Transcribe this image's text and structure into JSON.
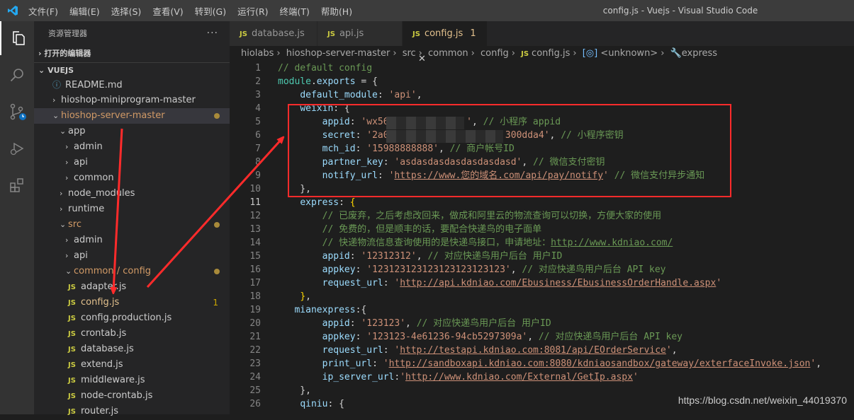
{
  "titlebar": {
    "menu": [
      "文件(F)",
      "编辑(E)",
      "选择(S)",
      "查看(V)",
      "转到(G)",
      "运行(R)",
      "终端(T)",
      "帮助(H)"
    ],
    "window_title": "config.js - Vuejs - Visual Studio Code"
  },
  "activity_icons": [
    "explorer-icon",
    "search-icon",
    "source-control-icon",
    "run-debug-icon",
    "extensions-icon"
  ],
  "sidebar": {
    "title": "资源管理器",
    "more": "···",
    "open_editors": "打开的编辑器",
    "workspace": "VUEJS",
    "tree": [
      {
        "label": "README.md",
        "icon": "info",
        "depth": 1
      },
      {
        "label": "hioshop-miniprogram-master",
        "icon": "chevron-right",
        "depth": 1
      },
      {
        "label": "hioshop-server-master",
        "icon": "chevron-down",
        "depth": 1,
        "selected": true,
        "dot": true,
        "git": true
      },
      {
        "label": "app",
        "icon": "chevron-down",
        "depth": 2
      },
      {
        "label": "admin",
        "icon": "chevron-right",
        "depth": 3
      },
      {
        "label": "api",
        "icon": "chevron-right",
        "depth": 3
      },
      {
        "label": "common",
        "icon": "chevron-right",
        "depth": 3
      },
      {
        "label": "node_modules",
        "icon": "chevron-right",
        "depth": 2
      },
      {
        "label": "runtime",
        "icon": "chevron-right",
        "depth": 2
      },
      {
        "label": "src",
        "icon": "chevron-down",
        "depth": 2,
        "dot": true,
        "git": true
      },
      {
        "label": "admin",
        "icon": "chevron-right",
        "depth": 3
      },
      {
        "label": "api",
        "icon": "chevron-right",
        "depth": 3
      },
      {
        "label": "common / config",
        "icon": "chevron-down",
        "depth": 3,
        "dot": true,
        "git": true
      },
      {
        "label": "adapter.js",
        "icon": "js",
        "depth": 4
      },
      {
        "label": "config.js",
        "icon": "js",
        "depth": 4,
        "badge": "1",
        "mod": true
      },
      {
        "label": "config.production.js",
        "icon": "js",
        "depth": 4
      },
      {
        "label": "crontab.js",
        "icon": "js",
        "depth": 4
      },
      {
        "label": "database.js",
        "icon": "js",
        "depth": 4
      },
      {
        "label": "extend.js",
        "icon": "js",
        "depth": 4
      },
      {
        "label": "middleware.js",
        "icon": "js",
        "depth": 4
      },
      {
        "label": "node-crontab.js",
        "icon": "js",
        "depth": 4
      },
      {
        "label": "router.js",
        "icon": "js",
        "depth": 4
      }
    ]
  },
  "tabs": [
    {
      "label": "database.js",
      "icon": "JS"
    },
    {
      "label": "api.js",
      "icon": "JS"
    },
    {
      "label": "config.js",
      "icon": "JS",
      "badge": "1",
      "active": true
    }
  ],
  "breadcrumb": [
    "hiolabs",
    "hioshop-server-master",
    "src",
    "common",
    "config",
    "config.js",
    "<unknown>",
    "express"
  ],
  "code": {
    "line_numbers": [
      "1",
      "2",
      "3",
      "4",
      "5",
      "6",
      "7",
      "8",
      "9",
      "10",
      "11",
      "12",
      "13",
      "14",
      "15",
      "16",
      "17",
      "18",
      "19",
      "20",
      "21",
      "22",
      "23",
      "24",
      "25",
      "26"
    ],
    "current_line": "11",
    "lines": [
      [
        [
          "com",
          "// default config"
        ]
      ],
      [
        [
          "mod",
          "module"
        ],
        [
          "ok",
          "."
        ],
        [
          "kw",
          "exports"
        ],
        [
          "ok",
          " = {"
        ]
      ],
      [
        [
          "ok",
          "    "
        ],
        [
          "kw",
          "default_module"
        ],
        [
          "ok",
          ": "
        ],
        [
          "str",
          "'api'"
        ],
        [
          "ok",
          ","
        ]
      ],
      [
        [
          "ok",
          "    "
        ],
        [
          "kw",
          "weixin"
        ],
        [
          "ok",
          ": {"
        ]
      ],
      [
        [
          "ok",
          "        "
        ],
        [
          "kw",
          "appid"
        ],
        [
          "ok",
          ": "
        ],
        [
          "str",
          "'wx56              '"
        ],
        [
          "ok",
          ", "
        ],
        [
          "com",
          "// 小程序 appid"
        ]
      ],
      [
        [
          "ok",
          "        "
        ],
        [
          "kw",
          "secret"
        ],
        [
          "ok",
          ": "
        ],
        [
          "str",
          "'2a0                     300dda4'"
        ],
        [
          "ok",
          ", "
        ],
        [
          "com",
          "// 小程序密钥"
        ]
      ],
      [
        [
          "ok",
          "        "
        ],
        [
          "kw",
          "mch_id"
        ],
        [
          "ok",
          ": "
        ],
        [
          "str",
          "'15988888888'"
        ],
        [
          "ok",
          ", "
        ],
        [
          "com",
          "// 商户帐号ID"
        ]
      ],
      [
        [
          "ok",
          "        "
        ],
        [
          "kw",
          "partner_key"
        ],
        [
          "ok",
          ": "
        ],
        [
          "str",
          "'asdasdasdasdasdasdasd'"
        ],
        [
          "ok",
          ", "
        ],
        [
          "com",
          "// 微信支付密钥"
        ]
      ],
      [
        [
          "ok",
          "        "
        ],
        [
          "kw",
          "notify_url"
        ],
        [
          "ok",
          ": "
        ],
        [
          "str",
          "'"
        ],
        [
          "url",
          "https://www.您的域名.com/api/pay/notify"
        ],
        [
          "str",
          "'"
        ],
        [
          "ok",
          " "
        ],
        [
          "com",
          "// 微信支付异步通知"
        ]
      ],
      [
        [
          "ok",
          "    },"
        ]
      ],
      [
        [
          "ok",
          "    "
        ],
        [
          "kw",
          "express"
        ],
        [
          "ok",
          ": "
        ],
        [
          "brk",
          "{"
        ]
      ],
      [
        [
          "ok",
          "        "
        ],
        [
          "com",
          "// 已废弃，之后考虑改回来，做成和阿里云的物流查询可以切换，方便大家的使用"
        ]
      ],
      [
        [
          "ok",
          "        "
        ],
        [
          "com",
          "// 免费的，但是顺丰的话，要配合快递鸟的电子面单"
        ]
      ],
      [
        [
          "ok",
          "        "
        ],
        [
          "com",
          "// 快递物流信息查询使用的是快递鸟接口，申请地址："
        ],
        [
          "curl",
          "http://www.kdniao.com/"
        ]
      ],
      [
        [
          "ok",
          "        "
        ],
        [
          "kw",
          "appid"
        ],
        [
          "ok",
          ": "
        ],
        [
          "str",
          "'12312312'"
        ],
        [
          "ok",
          ", "
        ],
        [
          "com",
          "// 对应快递鸟用户后台 用户ID"
        ]
      ],
      [
        [
          "ok",
          "        "
        ],
        [
          "kw",
          "appkey"
        ],
        [
          "ok",
          ": "
        ],
        [
          "str",
          "'123123123123123123123123'"
        ],
        [
          "ok",
          ", "
        ],
        [
          "com",
          "// 对应快递鸟用户后台 API key"
        ]
      ],
      [
        [
          "ok",
          "        "
        ],
        [
          "kw",
          "request_url"
        ],
        [
          "ok",
          ": "
        ],
        [
          "str",
          "'"
        ],
        [
          "url",
          "http://api.kdniao.com/Ebusiness/EbusinessOrderHandle.aspx"
        ],
        [
          "str",
          "'"
        ]
      ],
      [
        [
          "ok",
          "    "
        ],
        [
          "brk",
          "}"
        ],
        [
          "ok",
          ","
        ]
      ],
      [
        [
          "ok",
          "   "
        ],
        [
          "kw",
          "mianexpress"
        ],
        [
          "ok",
          ":{"
        ]
      ],
      [
        [
          "ok",
          "        "
        ],
        [
          "kw",
          "appid"
        ],
        [
          "ok",
          ": "
        ],
        [
          "str",
          "'123123'"
        ],
        [
          "ok",
          ", "
        ],
        [
          "com",
          "// 对应快递鸟用户后台 用户ID"
        ]
      ],
      [
        [
          "ok",
          "        "
        ],
        [
          "kw",
          "appkey"
        ],
        [
          "ok",
          ": "
        ],
        [
          "str",
          "'123123-4e61236-94cb5297309a'"
        ],
        [
          "ok",
          ", "
        ],
        [
          "com",
          "// 对应快递鸟用户后台 API key"
        ]
      ],
      [
        [
          "ok",
          "        "
        ],
        [
          "kw",
          "request_url"
        ],
        [
          "ok",
          ": "
        ],
        [
          "str",
          "'"
        ],
        [
          "url",
          "http://testapi.kdniao.com:8081/api/EOrderService"
        ],
        [
          "str",
          "'"
        ],
        [
          "ok",
          ","
        ]
      ],
      [
        [
          "ok",
          "        "
        ],
        [
          "kw",
          "print_url"
        ],
        [
          "ok",
          ": "
        ],
        [
          "str",
          "'"
        ],
        [
          "url",
          "http://sandboxapi.kdniao.com:8080/kdniaosandbox/gateway/exterfaceInvoke.json"
        ],
        [
          "str",
          "'"
        ],
        [
          "ok",
          ","
        ]
      ],
      [
        [
          "ok",
          "        "
        ],
        [
          "kw",
          "ip_server_url"
        ],
        [
          "ok",
          ":"
        ],
        [
          "str",
          "'"
        ],
        [
          "url",
          "http://www.kdniao.com/External/GetIp.aspx"
        ],
        [
          "str",
          "'"
        ]
      ],
      [
        [
          "ok",
          "    },"
        ]
      ],
      [
        [
          "ok",
          "    "
        ],
        [
          "kw",
          "qiniu"
        ],
        [
          "ok",
          ": {"
        ]
      ]
    ]
  },
  "watermark": "https://blog.csdn.net/weixin_44019370",
  "colors": {
    "annotation_red": "#ff2b2b",
    "js_yellow": "#cbcb41",
    "modified": "#e2c08d"
  }
}
